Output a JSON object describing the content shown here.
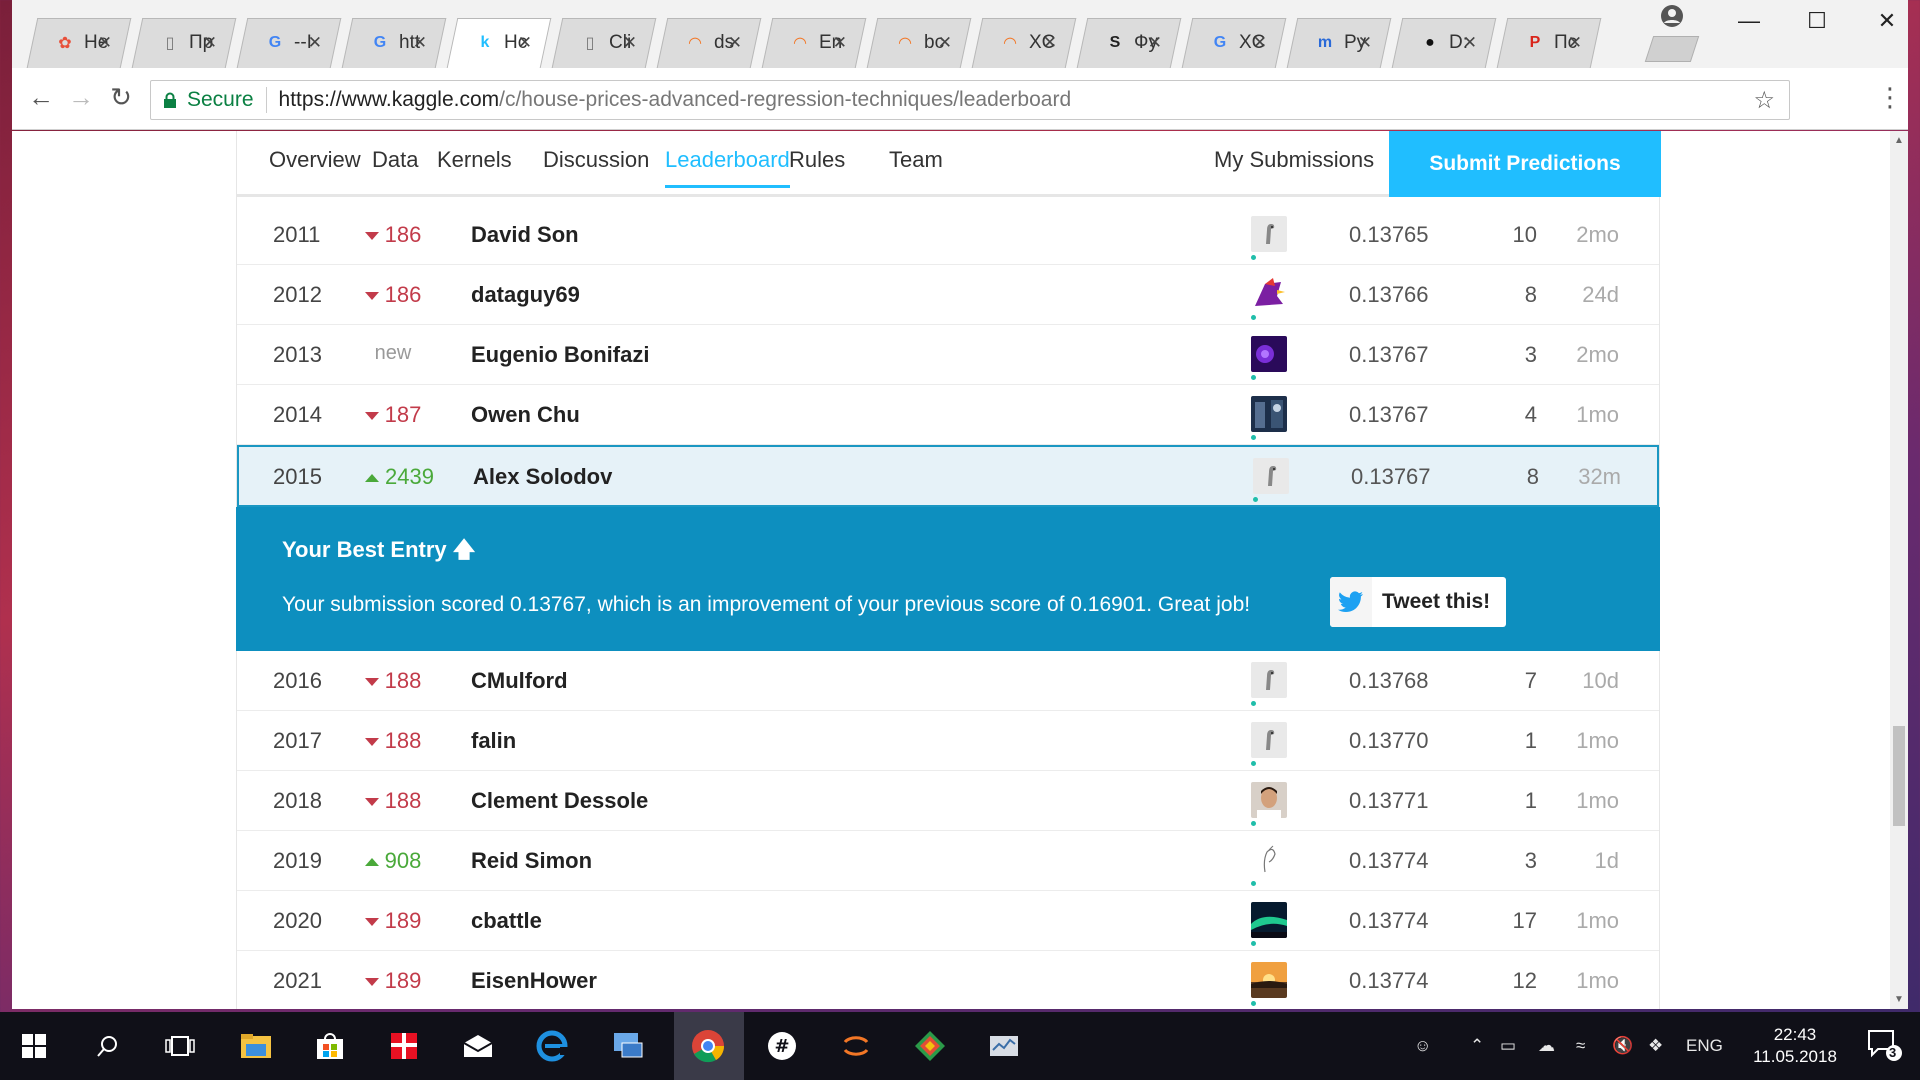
{
  "browser": {
    "tabs": [
      {
        "favicon": "pinwheel-icon",
        "title": "He",
        "active": false
      },
      {
        "favicon": "page-icon",
        "title": "Пр",
        "active": false
      },
      {
        "favicon": "google-icon",
        "title": "--I",
        "active": false
      },
      {
        "favicon": "google-icon",
        "title": "htt",
        "active": false
      },
      {
        "favicon": "kaggle-icon",
        "title": "Hc",
        "active": true
      },
      {
        "favicon": "page-icon",
        "title": "Cli",
        "active": false
      },
      {
        "favicon": "jupyter-icon",
        "title": "ds",
        "active": false
      },
      {
        "favicon": "jupyter-icon",
        "title": "En",
        "active": false
      },
      {
        "favicon": "jupyter-icon",
        "title": "bc",
        "active": false
      },
      {
        "favicon": "jupyter-icon",
        "title": "XC",
        "active": false
      },
      {
        "favicon": "s-icon",
        "title": "Фу",
        "active": false
      },
      {
        "favicon": "google-icon",
        "title": "XC",
        "active": false
      },
      {
        "favicon": "m-icon",
        "title": "Ру",
        "active": false
      },
      {
        "favicon": "github-icon",
        "title": "D:",
        "active": false
      },
      {
        "favicon": "rtc-icon",
        "title": "Пс",
        "active": false
      }
    ],
    "secure_label": "Secure",
    "url_host": "https://www.kaggle.com",
    "url_path": "/c/house-prices-advanced-regression-techniques/leaderboard"
  },
  "subnav": {
    "overview": "Overview",
    "data": "Data",
    "kernels": "Kernels",
    "discussion": "Discussion",
    "leaderboard": "Leaderboard",
    "rules": "Rules",
    "team": "Team",
    "my_submissions": "My Submissions",
    "submit": "Submit Predictions"
  },
  "leaderboard": {
    "rows_before": [
      {
        "rank": "2011",
        "delta": "186",
        "dir": "down",
        "name": "David Son",
        "avatar": "default",
        "score": "0.13765",
        "entries": "10",
        "last": "2mo"
      },
      {
        "rank": "2012",
        "delta": "186",
        "dir": "down",
        "name": "dataguy69",
        "avatar": "bird",
        "score": "0.13766",
        "entries": "8",
        "last": "24d"
      },
      {
        "rank": "2013",
        "delta": "new",
        "dir": "new",
        "name": "Eugenio Bonifazi",
        "avatar": "purple",
        "score": "0.13767",
        "entries": "3",
        "last": "2mo"
      },
      {
        "rank": "2014",
        "delta": "187",
        "dir": "down",
        "name": "Owen Chu",
        "avatar": "blue-photo",
        "score": "0.13767",
        "entries": "4",
        "last": "1mo"
      }
    ],
    "mine": {
      "rank": "2015",
      "delta": "2439",
      "dir": "up",
      "name": "Alex Solodov",
      "avatar": "default",
      "score": "0.13767",
      "entries": "8",
      "last": "32m"
    },
    "best_entry": {
      "title": "Your Best Entry",
      "message": "Your submission scored 0.13767, which is an improvement of your previous score of 0.16901. Great job!",
      "tweet": "Tweet this!"
    },
    "rows_after": [
      {
        "rank": "2016",
        "delta": "188",
        "dir": "down",
        "name": "CMulford",
        "avatar": "default",
        "score": "0.13768",
        "entries": "7",
        "last": "10d"
      },
      {
        "rank": "2017",
        "delta": "188",
        "dir": "down",
        "name": "falin",
        "avatar": "default",
        "score": "0.13770",
        "entries": "1",
        "last": "1mo"
      },
      {
        "rank": "2018",
        "delta": "188",
        "dir": "down",
        "name": "Clement Dessole",
        "avatar": "face",
        "score": "0.13771",
        "entries": "1",
        "last": "1mo"
      },
      {
        "rank": "2019",
        "delta": "908",
        "dir": "up",
        "name": "Reid Simon",
        "avatar": "sketch",
        "score": "0.13774",
        "entries": "3",
        "last": "1d"
      },
      {
        "rank": "2020",
        "delta": "189",
        "dir": "down",
        "name": "cbattle",
        "avatar": "aurora",
        "score": "0.13774",
        "entries": "17",
        "last": "1mo"
      },
      {
        "rank": "2021",
        "delta": "189",
        "dir": "down",
        "name": "EisenHower",
        "avatar": "sunset",
        "score": "0.13774",
        "entries": "12",
        "last": "1mo"
      }
    ]
  },
  "taskbar": {
    "lang": "ENG",
    "time": "22:43",
    "date": "11.05.2018",
    "notifications": "3"
  },
  "colors": {
    "accent": "#20beff",
    "best_entry_bg": "#0d8fbf",
    "down": "#c23b4a",
    "up": "#4aa93a"
  }
}
